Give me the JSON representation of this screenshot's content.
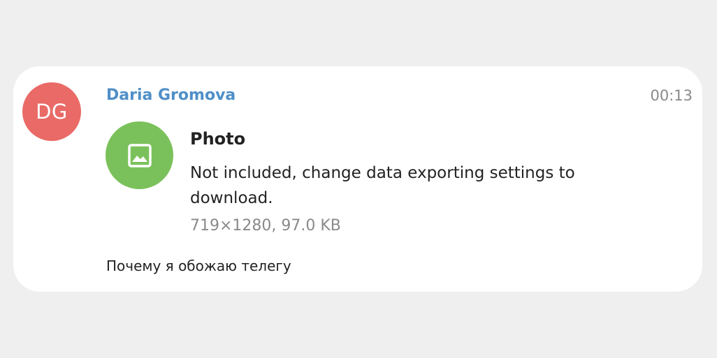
{
  "message": {
    "author_initials": "DG",
    "author_name": "Daria Gromova",
    "time": "00:13",
    "media": {
      "icon": "image-icon",
      "title": "Photo",
      "description": "Not included, change data exporting settings to download.",
      "meta": "719×1280, 97.0 KB"
    },
    "caption": "Почему я обожаю телегу"
  },
  "colors": {
    "avatar_bg": "#e96a66",
    "author_name": "#4f8fc8",
    "media_icon_bg": "#7bc15b",
    "page_bg": "#efefef",
    "card_bg": "#ffffff"
  }
}
